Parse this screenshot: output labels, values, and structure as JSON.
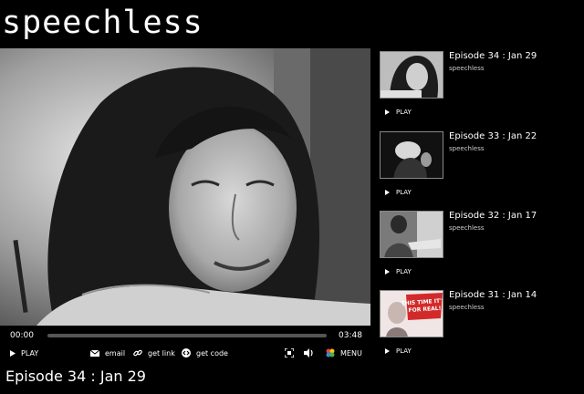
{
  "site": {
    "title": "speechless"
  },
  "player": {
    "current_time": "00:00",
    "total_time": "03:48",
    "progress": 0,
    "play_label": "PLAY",
    "email_label": "email",
    "link_label": "get link",
    "code_label": "get code",
    "menu_label": "MENU"
  },
  "now_playing": {
    "title": "Episode 34 : Jan 29"
  },
  "playlist": [
    {
      "title": "Episode 34 : Jan 29",
      "subtitle": "speechless",
      "play_label": "PLAY"
    },
    {
      "title": "Episode 33 : Jan 22",
      "subtitle": "speechless",
      "play_label": "PLAY"
    },
    {
      "title": "Episode 32 : Jan 17",
      "subtitle": "speechless",
      "play_label": "PLAY"
    },
    {
      "title": "Episode 31 : Jan 14",
      "subtitle": "speechless",
      "play_label": "PLAY",
      "thumb_text": "THIS TIME IT'S FOR REAL!"
    }
  ]
}
